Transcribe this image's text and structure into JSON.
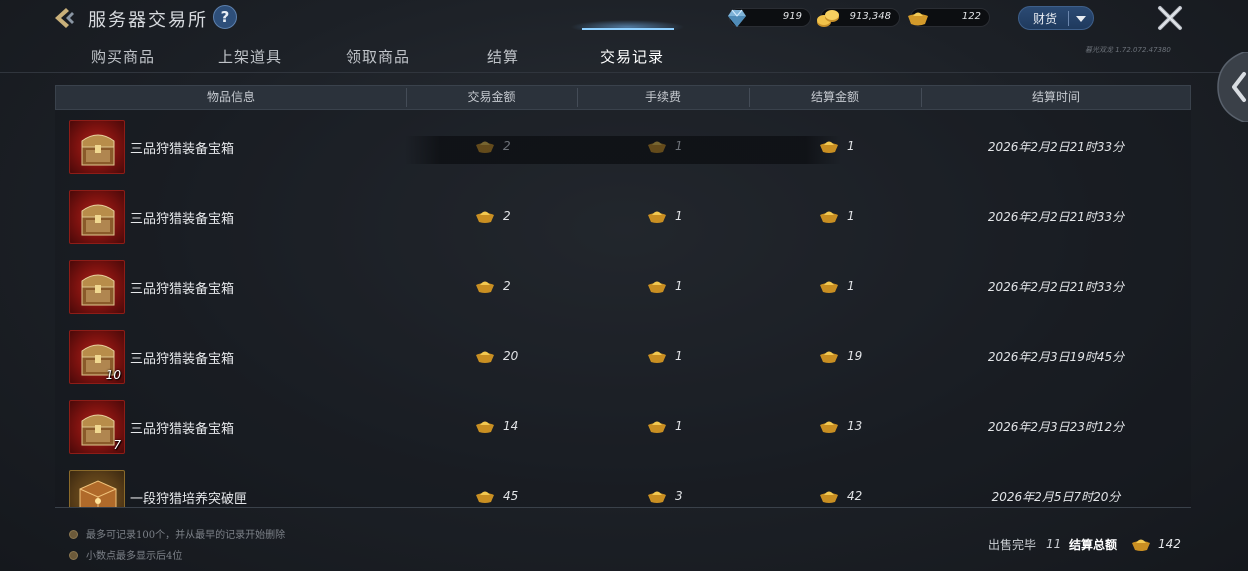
{
  "header": {
    "title": "服务器交易所",
    "help_label": "?",
    "version": "暮光双龙 1.72.072.47380"
  },
  "currencies": [
    {
      "name": "diamond",
      "icon": "diamond-icon",
      "value": "919"
    },
    {
      "name": "gold",
      "icon": "gold-coins-icon",
      "value": "913,348"
    },
    {
      "name": "ingot",
      "icon": "gold-ingot-icon",
      "value": "122"
    }
  ],
  "wealth_button": {
    "label": "财货"
  },
  "tabs": [
    {
      "label": "购买商品",
      "active": false
    },
    {
      "label": "上架道具",
      "active": false
    },
    {
      "label": "领取商品",
      "active": false
    },
    {
      "label": "结算",
      "active": false
    },
    {
      "label": "交易记录",
      "active": true
    }
  ],
  "table": {
    "columns": [
      "物品信息",
      "交易金额",
      "手续费",
      "结算金额",
      "结算时间"
    ],
    "rows": [
      {
        "name": "三品狩猎装备宝箱",
        "icon": "treasure-chest-icon",
        "qty": "",
        "amount": "2",
        "fee": "1",
        "settled": "1",
        "time": "2026年2月2日21时33分",
        "dim": true
      },
      {
        "name": "三品狩猎装备宝箱",
        "icon": "treasure-chest-icon",
        "qty": "",
        "amount": "2",
        "fee": "1",
        "settled": "1",
        "time": "2026年2月2日21时33分",
        "dim": false
      },
      {
        "name": "三品狩猎装备宝箱",
        "icon": "treasure-chest-icon",
        "qty": "",
        "amount": "2",
        "fee": "1",
        "settled": "1",
        "time": "2026年2月2日21时33分",
        "dim": false
      },
      {
        "name": "三品狩猎装备宝箱",
        "icon": "treasure-chest-icon",
        "qty": "10",
        "amount": "20",
        "fee": "1",
        "settled": "19",
        "time": "2026年2月3日19时45分",
        "dim": false
      },
      {
        "name": "三品狩猎装备宝箱",
        "icon": "treasure-chest-icon",
        "qty": "7",
        "amount": "14",
        "fee": "1",
        "settled": "13",
        "time": "2026年2月3日23时12分",
        "dim": false
      },
      {
        "name": "一段狩猎培养突破匣",
        "icon": "breakthrough-box-icon",
        "qty": "",
        "amount": "45",
        "fee": "3",
        "settled": "42",
        "time": "2026年2月5日7时20分",
        "dim": false
      }
    ]
  },
  "footer": {
    "notes": [
      "最多可记录100个，并从最早的记录开始删除",
      "小数点最多显示后4位"
    ],
    "sold_label": "出售完毕",
    "sold_value": "11",
    "total_label": "结算总额",
    "total_value": "142"
  },
  "colors": {
    "accent_blue": "#8fd0ff",
    "tab_button_blue": "#2b4a73",
    "item_red": "#b2231b",
    "gold": "#e0b23a"
  }
}
